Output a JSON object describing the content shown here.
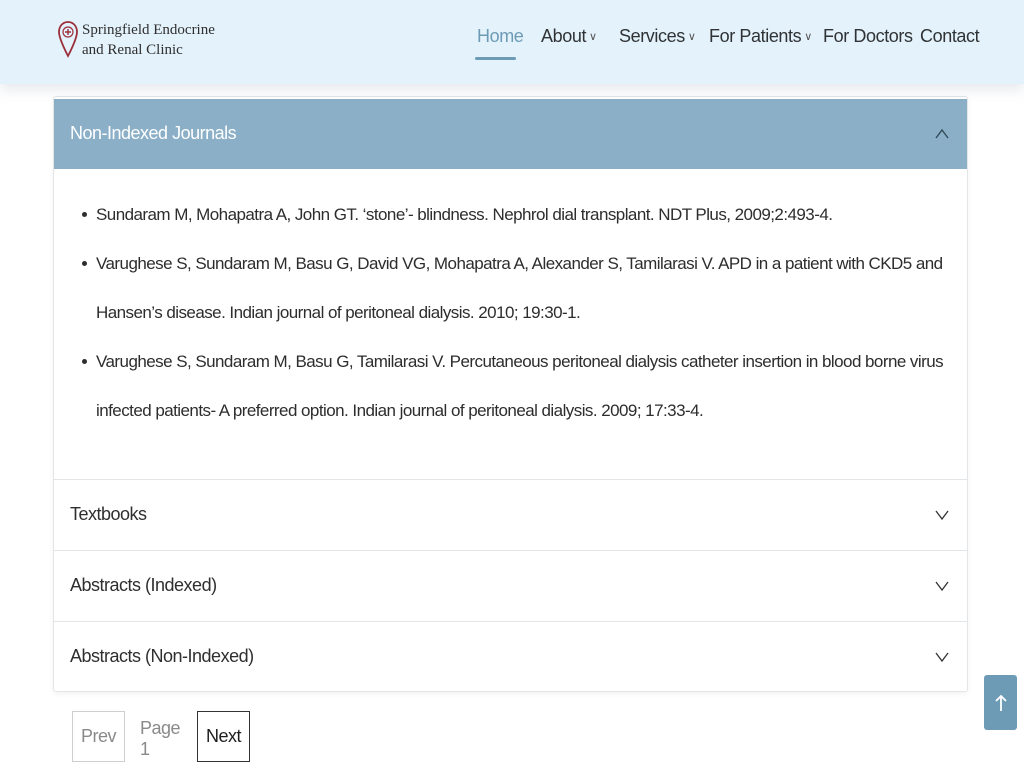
{
  "header": {
    "logo_line1": "Springfield Endocrine",
    "logo_line2": "and Renal Clinic",
    "nav": {
      "home": "Home",
      "about": "About",
      "services": "Services",
      "for_patients": "For Patients",
      "for_doctors": "For Doctors",
      "contact": "Contact"
    }
  },
  "accordion": {
    "open_section": {
      "title": "Non-Indexed Journals",
      "items": [
        "Sundaram M, Mohapatra A, John GT. ‘stone’- blindness. Nephrol dial transplant. NDT Plus, 2009;2:493-4.",
        "Varughese S, Sundaram M, Basu G, David VG, Mohapatra A, Alexander S, Tamilarasi V. APD in a patient with CKD5 and Hansen’s disease. Indian journal of peritoneal dialysis. 2010; 19:30-1.",
        "Varughese S, Sundaram M, Basu G, Tamilarasi V. Percutaneous peritoneal dialysis catheter insertion in blood borne virus infected patients- A preferred option. Indian journal of peritoneal dialysis. 2009; 17:33-4."
      ]
    },
    "collapsed_sections": [
      "Textbooks",
      "Abstracts (Indexed)",
      "Abstracts (Non-Indexed)"
    ]
  },
  "pagination": {
    "prev": "Prev",
    "page": "Page 1",
    "next": "Next"
  },
  "colors": {
    "header_bg": "#e4f2fb",
    "accent": "#6d9bb6",
    "accordion_open_bg": "#8aafc7"
  }
}
